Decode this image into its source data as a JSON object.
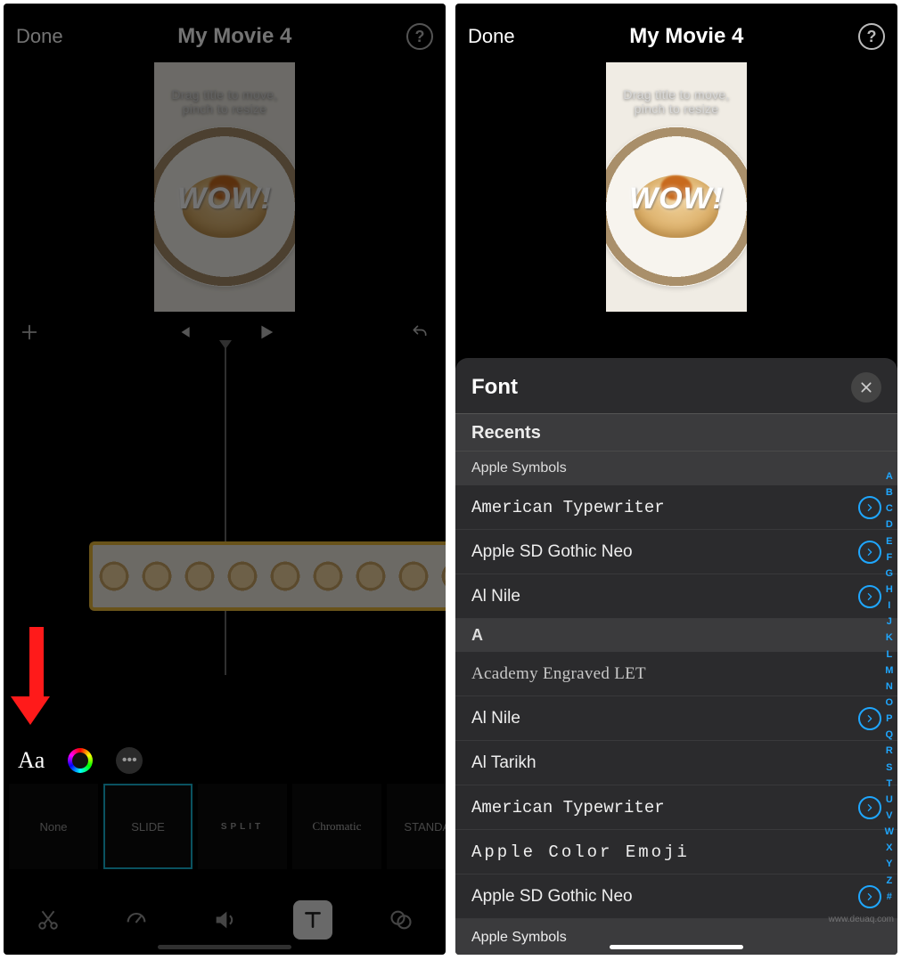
{
  "left": {
    "header": {
      "done": "Done",
      "title": "My Movie 4"
    },
    "preview": {
      "hint": "Drag title to move, pinch to resize",
      "title_text": "WOW!"
    },
    "clip_badge": "T",
    "presets": [
      {
        "label": "None"
      },
      {
        "label": "SLIDE",
        "selected": true
      },
      {
        "label": "SPLIT",
        "cls": "split"
      },
      {
        "label": "Chromatic",
        "cls": "chromatic"
      },
      {
        "label": "STANDAR"
      }
    ],
    "style_bar": {
      "font_btn": "Aa",
      "more": "•••"
    }
  },
  "right": {
    "header": {
      "done": "Done",
      "title": "My Movie 4"
    },
    "preview": {
      "hint": "Drag title to move, pinch to resize",
      "title_text": "WOW!"
    },
    "font_panel": {
      "title": "Font",
      "recents_header": "Recents",
      "recent_item": "Apple  Symbols",
      "letter_header": "A",
      "rows": [
        {
          "name": "American Typewriter",
          "chev": true,
          "cls": "typewriter"
        },
        {
          "name": "Apple SD Gothic Neo",
          "chev": true,
          "cls": "thin"
        },
        {
          "name": "Al Nile",
          "chev": true
        },
        {
          "name": "Academy Engraved LET",
          "chev": false,
          "cls": "engraved"
        },
        {
          "name": "Al Nile",
          "chev": true
        },
        {
          "name": "Al Tarikh",
          "chev": false
        },
        {
          "name": "American Typewriter",
          "chev": true,
          "cls": "typewriter"
        },
        {
          "name": "Apple  Color  Emoji",
          "chev": false,
          "cls": "mono"
        },
        {
          "name": "Apple SD Gothic Neo",
          "chev": true,
          "cls": "thin"
        },
        {
          "name": "Apple  Symbols",
          "chev": false,
          "cls": "highlight"
        }
      ],
      "index": [
        "A",
        "B",
        "C",
        "D",
        "E",
        "F",
        "G",
        "H",
        "I",
        "J",
        "K",
        "L",
        "M",
        "N",
        "O",
        "P",
        "Q",
        "R",
        "S",
        "T",
        "U",
        "V",
        "W",
        "X",
        "Y",
        "Z",
        "#"
      ]
    }
  },
  "watermark": "www.deuaq.com"
}
